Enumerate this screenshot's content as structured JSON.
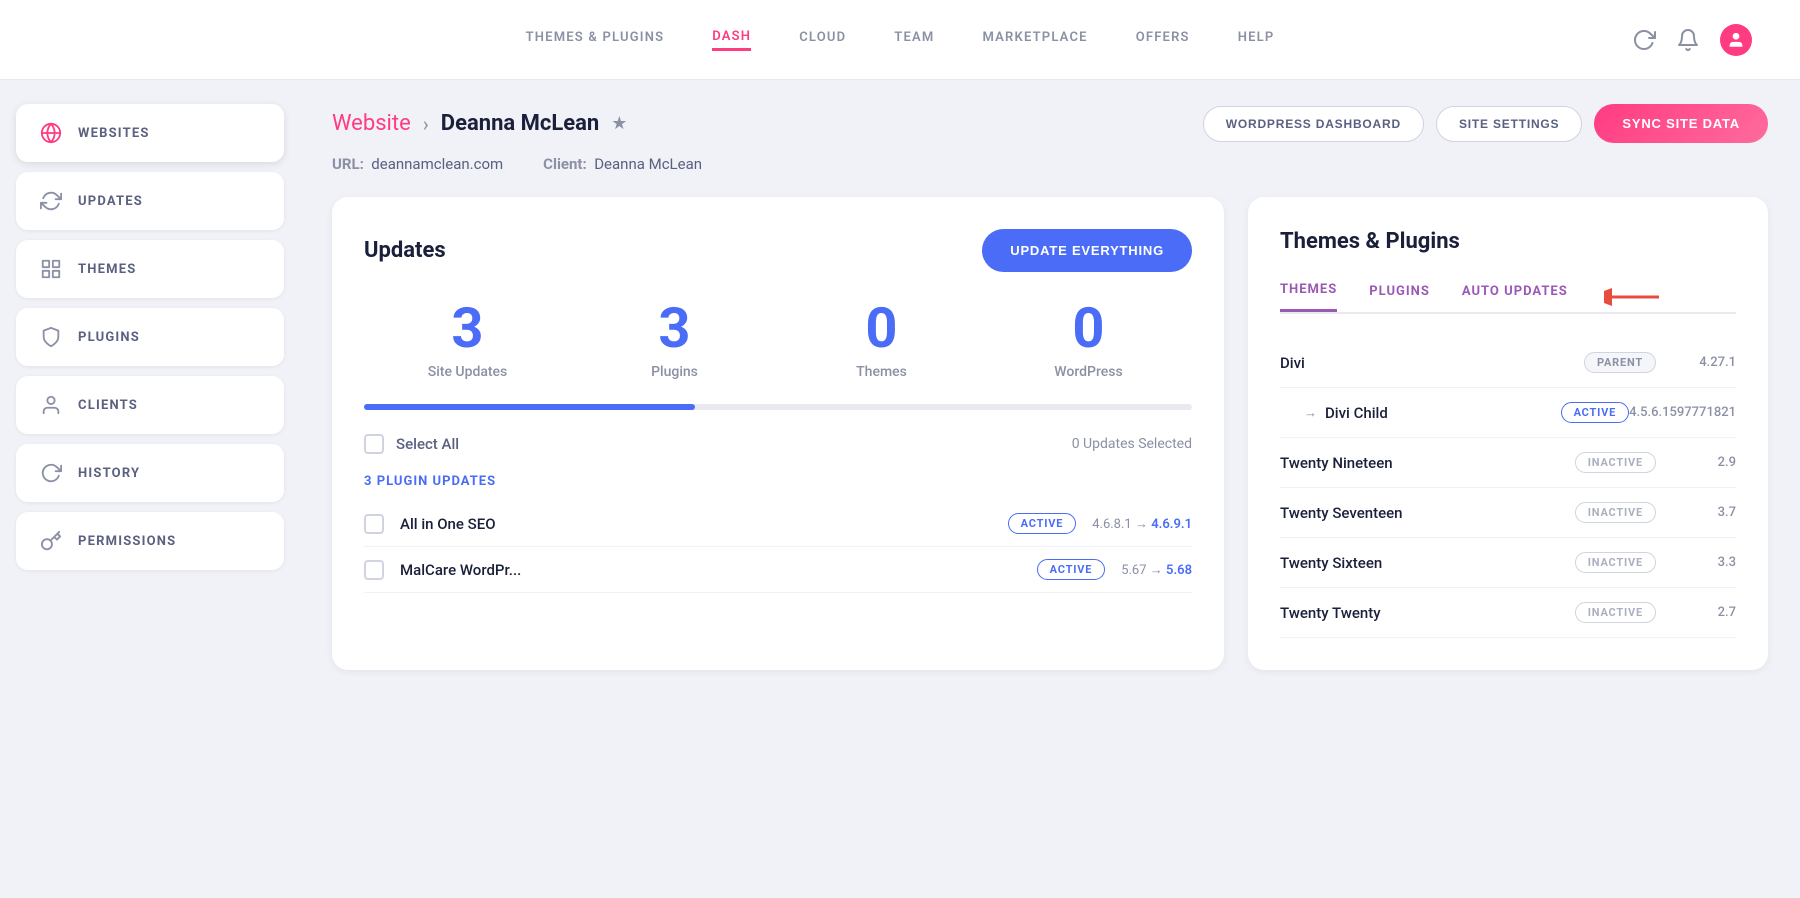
{
  "nav": {
    "links": [
      {
        "id": "themes-plugins",
        "label": "THEMES & PLUGINS",
        "active": false
      },
      {
        "id": "dash",
        "label": "DASH",
        "active": true
      },
      {
        "id": "cloud",
        "label": "CLOUD",
        "active": false
      },
      {
        "id": "team",
        "label": "TEAM",
        "active": false
      },
      {
        "id": "marketplace",
        "label": "MARKETPLACE",
        "active": false
      },
      {
        "id": "offers",
        "label": "OFFERS",
        "active": false
      },
      {
        "id": "help",
        "label": "HELP",
        "active": false
      }
    ]
  },
  "sidebar": {
    "items": [
      {
        "id": "websites",
        "label": "WEBSITES",
        "icon": "globe",
        "active": true
      },
      {
        "id": "updates",
        "label": "UPDATES",
        "icon": "refresh"
      },
      {
        "id": "themes",
        "label": "THEMES",
        "icon": "layout"
      },
      {
        "id": "plugins",
        "label": "PLUGINS",
        "icon": "shield"
      },
      {
        "id": "clients",
        "label": "CLIENTS",
        "icon": "user"
      },
      {
        "id": "history",
        "label": "HISTORY",
        "icon": "clock"
      },
      {
        "id": "permissions",
        "label": "PERMISSIONS",
        "icon": "key"
      }
    ]
  },
  "page": {
    "breadcrumb_website": "Website",
    "breadcrumb_arrow": "›",
    "site_name": "Deanna McLean",
    "url_label": "URL:",
    "url_value": "deannamclean.com",
    "client_label": "Client:",
    "client_value": "Deanna McLean",
    "btn_wordpress": "WORDPRESS DASHBOARD",
    "btn_settings": "SITE SETTINGS",
    "btn_sync": "SYNC SITE DATA"
  },
  "updates": {
    "title": "Updates",
    "btn_update": "UPDATE EVERYTHING",
    "stats": [
      {
        "number": "3",
        "label": "Site Updates"
      },
      {
        "number": "3",
        "label": "Plugins"
      },
      {
        "number": "0",
        "label": "Themes"
      },
      {
        "number": "0",
        "label": "WordPress"
      }
    ],
    "select_all": "Select All",
    "updates_selected": "0 Updates Selected",
    "section_title": "3 PLUGIN UPDATES",
    "plugins": [
      {
        "name": "All in One SEO",
        "badge": "ACTIVE",
        "version_from": "4.6.8.1",
        "version_to": "4.6.9.1"
      },
      {
        "name": "MalCare WordPr...",
        "badge": "ACTIVE",
        "version_from": "5.67",
        "version_to": "5.68"
      }
    ]
  },
  "themes_plugins": {
    "title": "Themes & Plugins",
    "tabs": [
      {
        "id": "themes",
        "label": "THEMES",
        "active": true
      },
      {
        "id": "plugins",
        "label": "PLUGINS",
        "active": false
      },
      {
        "id": "auto-updates",
        "label": "AUTO UPDATES",
        "active": false
      }
    ],
    "themes_list": [
      {
        "name": "Divi",
        "badge_type": "parent",
        "badge_label": "PARENT",
        "version": "4.27.1",
        "indent": false
      },
      {
        "name": "Divi Child",
        "badge_type": "active",
        "badge_label": "ACTIVE",
        "version": "4.5.6.1597771821",
        "indent": true
      },
      {
        "name": "Twenty Nineteen",
        "badge_type": "inactive",
        "badge_label": "INACTIVE",
        "version": "2.9",
        "indent": false
      },
      {
        "name": "Twenty Seventeen",
        "badge_type": "inactive",
        "badge_label": "INACTIVE",
        "version": "3.7",
        "indent": false
      },
      {
        "name": "Twenty Sixteen",
        "badge_type": "inactive",
        "badge_label": "INACTIVE",
        "version": "3.3",
        "indent": false
      },
      {
        "name": "Twenty Twenty",
        "badge_type": "inactive",
        "badge_label": "INACTIVE",
        "version": "2.7",
        "indent": false
      }
    ]
  }
}
